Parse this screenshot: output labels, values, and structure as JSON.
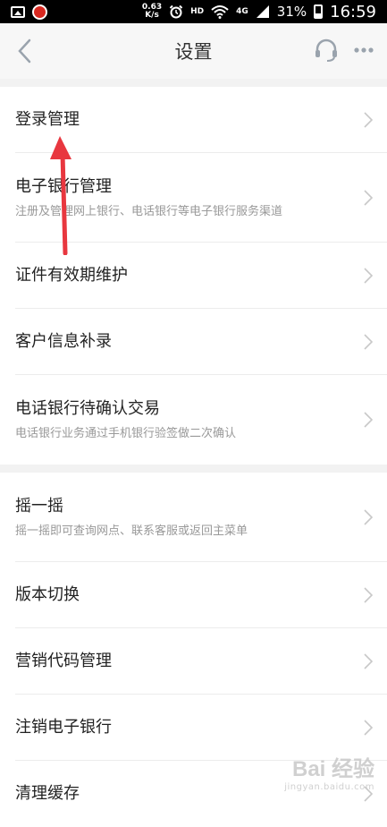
{
  "status_bar": {
    "speed_value": "0.63",
    "speed_unit": "K/s",
    "hd": "HD",
    "network": "4G",
    "battery": "31%",
    "time": "16:59"
  },
  "nav": {
    "title": "设置"
  },
  "groups": [
    {
      "items": [
        {
          "title": "登录管理",
          "subtitle": ""
        },
        {
          "title": "电子银行管理",
          "subtitle": "注册及管理网上银行、电话银行等电子银行服务渠道"
        },
        {
          "title": "证件有效期维护",
          "subtitle": ""
        },
        {
          "title": "客户信息补录",
          "subtitle": ""
        },
        {
          "title": "电话银行待确认交易",
          "subtitle": "电话银行业务通过手机银行验签做二次确认"
        }
      ]
    },
    {
      "items": [
        {
          "title": "摇一摇",
          "subtitle": "摇一摇即可查询网点、联系客服或返回主菜单"
        },
        {
          "title": "版本切换",
          "subtitle": ""
        },
        {
          "title": "营销代码管理",
          "subtitle": ""
        },
        {
          "title": "注销电子银行",
          "subtitle": ""
        },
        {
          "title": "清理缓存",
          "subtitle": ""
        }
      ]
    }
  ],
  "watermark": {
    "logo": "Bai 经验",
    "url": "jingyan.baidu.com"
  },
  "colors": {
    "annotation_arrow": "#e8373f",
    "icon_gray": "#9aa3ad"
  }
}
